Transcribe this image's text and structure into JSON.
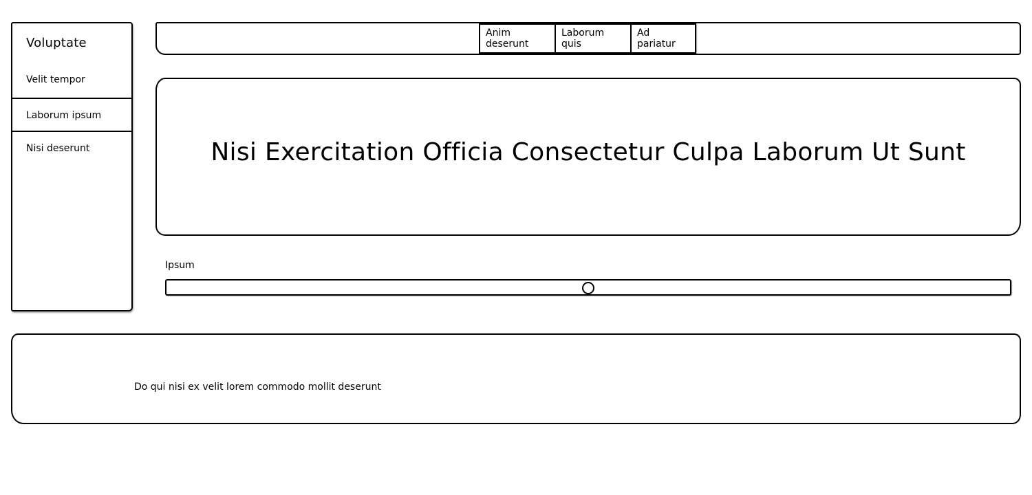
{
  "sidebar": {
    "title": "Voluptate",
    "items": [
      {
        "label": "Velit tempor"
      },
      {
        "label": "Laborum ipsum"
      },
      {
        "label": "Nisi deserunt"
      }
    ]
  },
  "nav": {
    "buttons": [
      {
        "label": "Anim deserunt"
      },
      {
        "label": "Laborum quis"
      },
      {
        "label": "Ad pariatur"
      }
    ]
  },
  "hero": {
    "title": "Nisi Exercitation Officia Consectetur Culpa Laborum Ut Sunt"
  },
  "slider": {
    "label": "Ipsum",
    "value_fraction": 0.5
  },
  "footer": {
    "text": "Do qui nisi ex velit lorem commodo mollit deserunt"
  }
}
